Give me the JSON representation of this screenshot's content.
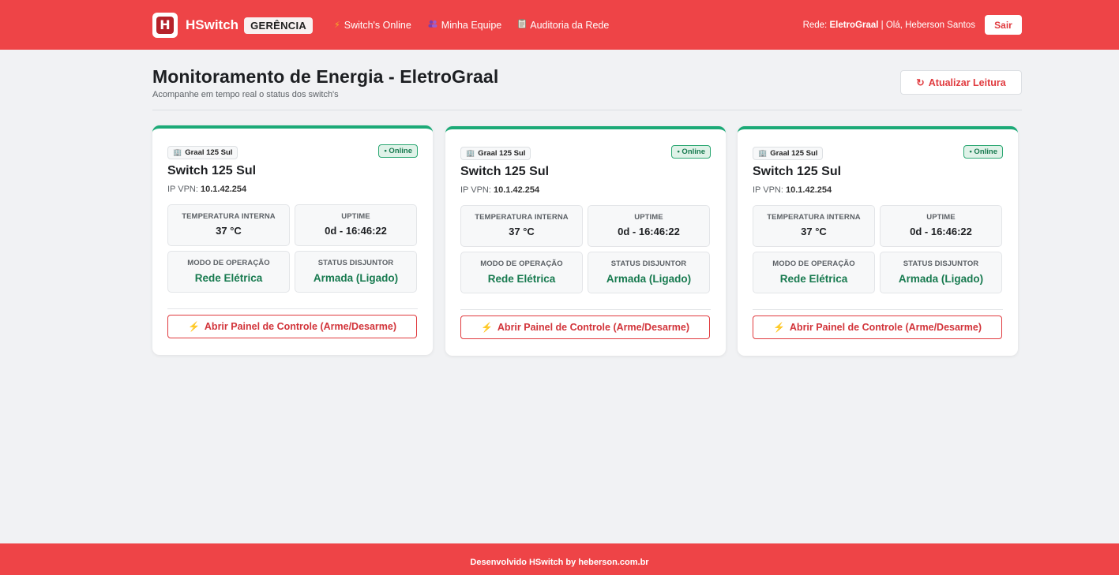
{
  "navbar": {
    "brand_letter": "H",
    "brand_name": "HSwitch",
    "brand_badge": "GERÊNCIA",
    "links": [
      {
        "label": "Switch's Online",
        "icon": "bolt-icon"
      },
      {
        "label": "Minha Equipe",
        "icon": "team-icon"
      },
      {
        "label": "Auditoria da Rede",
        "icon": "clipboard-icon"
      }
    ],
    "network_prefix": "Rede:",
    "network_name": "EletroGraal",
    "greeting": "| Olá, Heberson Santos",
    "logout_label": "Sair"
  },
  "header": {
    "title": "Monitoramento de Energia - EletroGraal",
    "subtitle": "Acompanhe em tempo real o status dos switch's",
    "refresh_label": "Atualizar Leitura"
  },
  "cards": [
    {
      "location": "Graal 125 Sul",
      "status": "• Online",
      "name": "Switch 125 Sul",
      "ip_label": "IP VPN:",
      "ip": "10.1.42.254",
      "temp_label": "TEMPERATURA INTERNA",
      "temp_value": "37 °C",
      "uptime_label": "UPTIME",
      "uptime_value": "0d - 16:46:22",
      "mode_label": "MODO DE OPERAÇÃO",
      "mode_value": "Rede Elétrica",
      "breaker_label": "STATUS DISJUNTOR",
      "breaker_value": "Armada (Ligado)",
      "panel_label": "Abrir Painel de Controle (Arme/Desarme)"
    },
    {
      "location": "Graal 125 Sul",
      "status": "• Online",
      "name": "Switch 125 Sul",
      "ip_label": "IP VPN:",
      "ip": "10.1.42.254",
      "temp_label": "TEMPERATURA INTERNA",
      "temp_value": "37 °C",
      "uptime_label": "UPTIME",
      "uptime_value": "0d - 16:46:22",
      "mode_label": "MODO DE OPERAÇÃO",
      "mode_value": "Rede Elétrica",
      "breaker_label": "STATUS DISJUNTOR",
      "breaker_value": "Armada (Ligado)",
      "panel_label": "Abrir Painel de Controle (Arme/Desarme)"
    },
    {
      "location": "Graal 125 Sul",
      "status": "• Online",
      "name": "Switch 125 Sul",
      "ip_label": "IP VPN:",
      "ip": "10.1.42.254",
      "temp_label": "TEMPERATURA INTERNA",
      "temp_value": "37 °C",
      "uptime_label": "UPTIME",
      "uptime_value": "0d - 16:46:22",
      "mode_label": "MODO DE OPERAÇÃO",
      "mode_value": "Rede Elétrica",
      "breaker_label": "STATUS DISJUNTOR",
      "breaker_value": "Armada (Ligado)",
      "panel_label": "Abrir Painel de Controle (Arme/Desarme)"
    }
  ],
  "footer": {
    "text": "Desenvolvido HSwitch by heberson.com.br"
  },
  "colors": {
    "brand_red": "#ee4447",
    "online_green": "#1caa77",
    "value_green": "#177a4f",
    "background": "#f1f2f4"
  }
}
